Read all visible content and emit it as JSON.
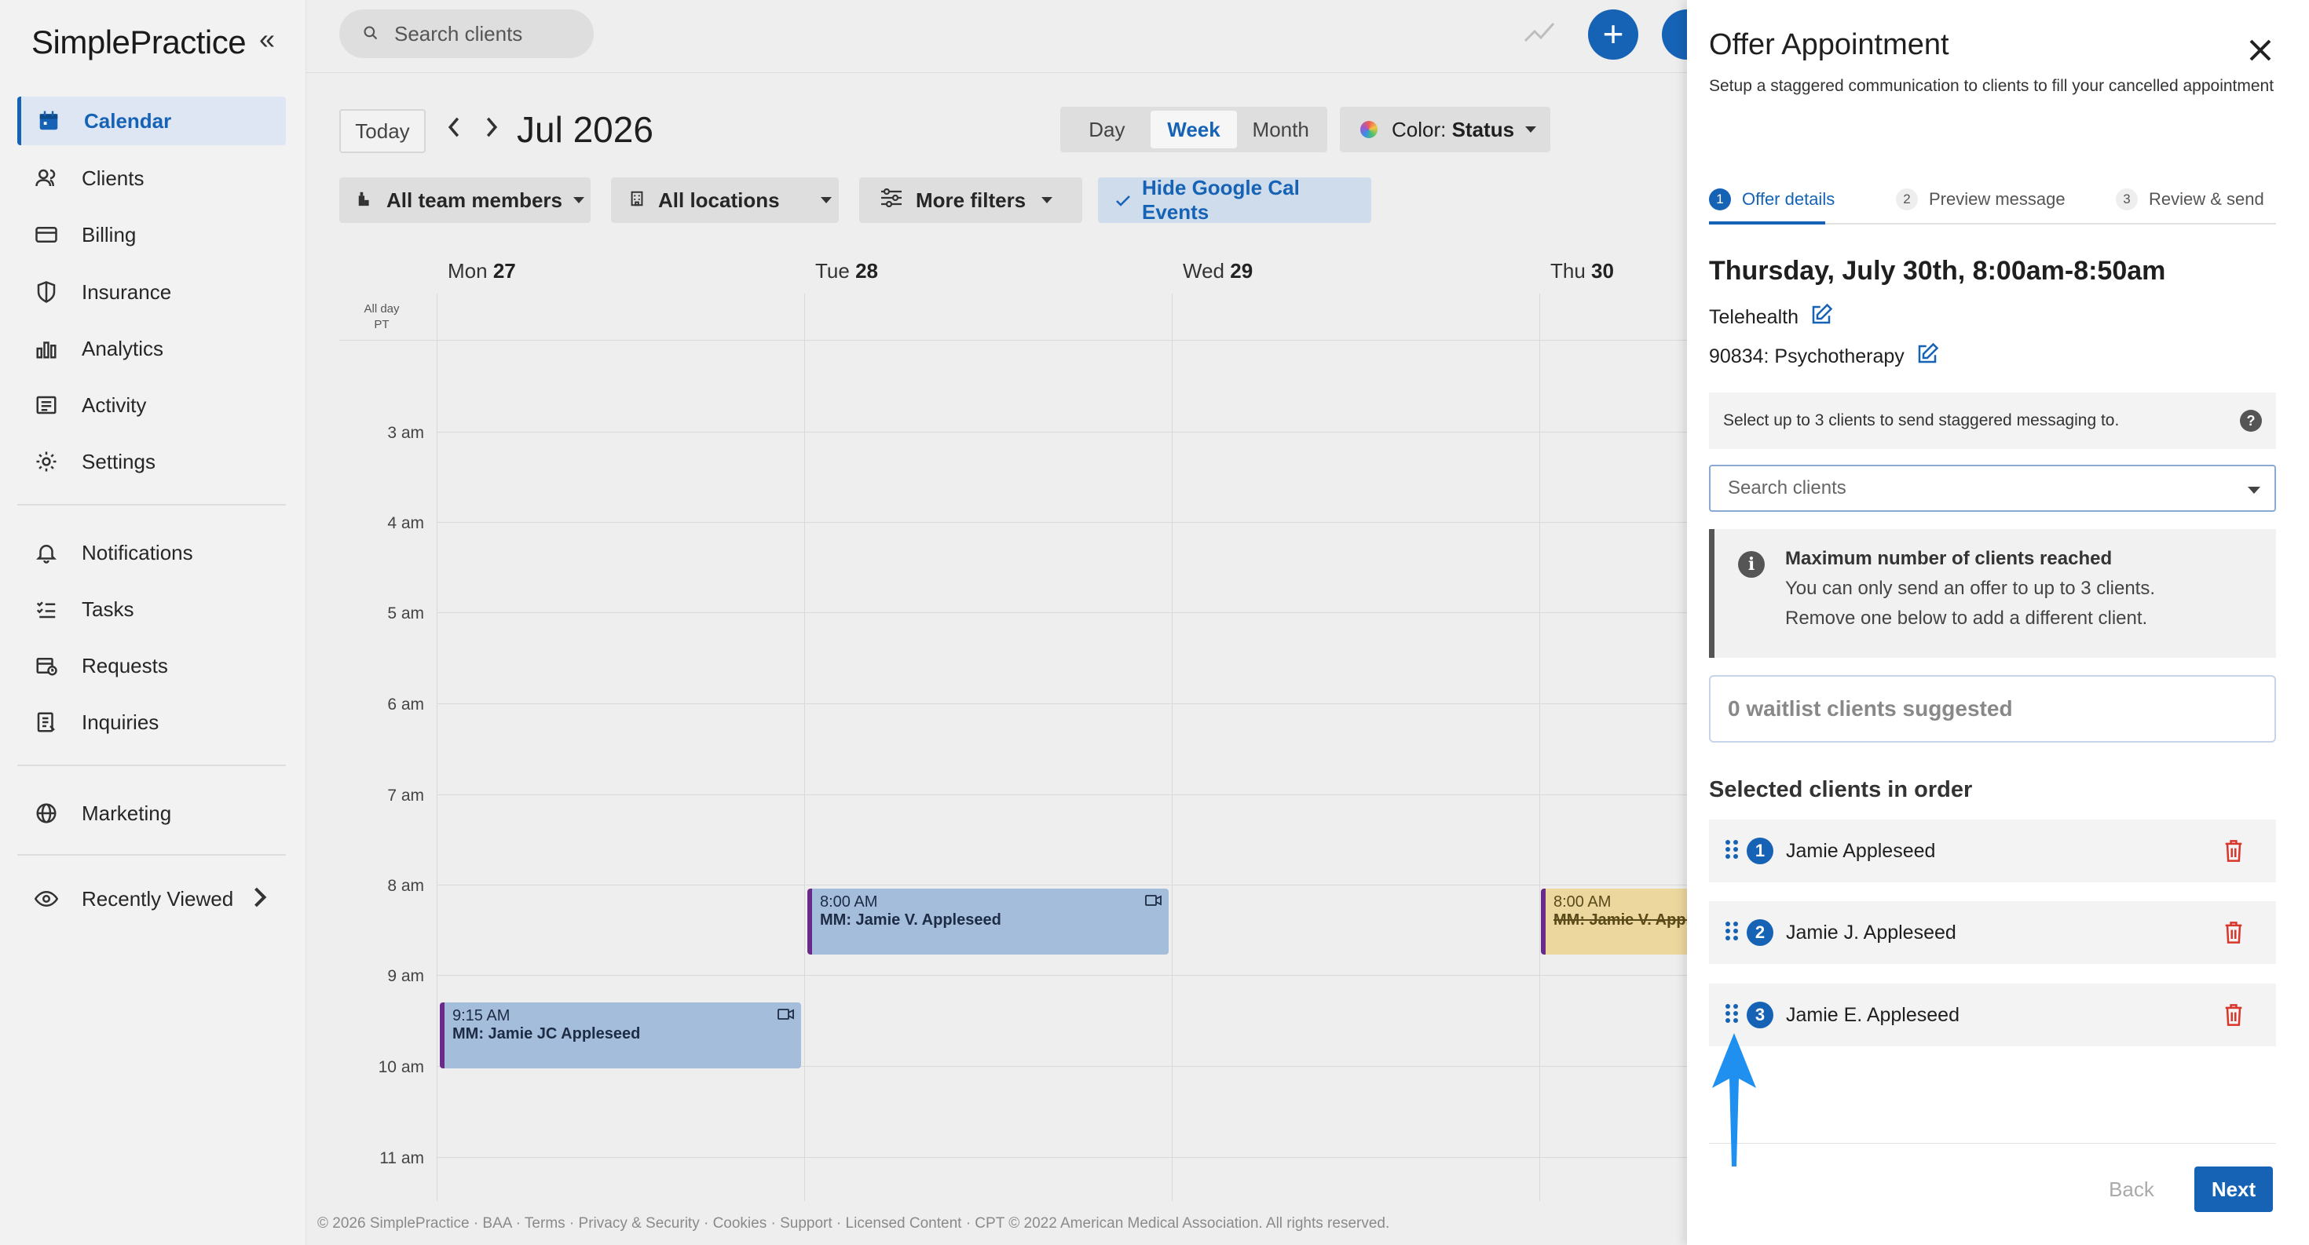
{
  "app": {
    "logo": "SimplePractice",
    "collapse": "«"
  },
  "sidebar": {
    "items": [
      {
        "label": "Calendar",
        "icon": "calendar-icon"
      },
      {
        "label": "Clients",
        "icon": "clients-icon"
      },
      {
        "label": "Billing",
        "icon": "billing-icon"
      },
      {
        "label": "Insurance",
        "icon": "shield-icon"
      },
      {
        "label": "Analytics",
        "icon": "bar-chart-icon"
      },
      {
        "label": "Activity",
        "icon": "activity-icon"
      },
      {
        "label": "Settings",
        "icon": "gear-icon"
      },
      {
        "label": "Notifications",
        "icon": "bell-icon"
      },
      {
        "label": "Tasks",
        "icon": "tasks-icon"
      },
      {
        "label": "Requests",
        "icon": "requests-icon"
      },
      {
        "label": "Inquiries",
        "icon": "inquiries-icon"
      },
      {
        "label": "Marketing",
        "icon": "globe-icon"
      },
      {
        "label": "Recently Viewed",
        "icon": "eye-icon"
      }
    ],
    "active": "Calendar"
  },
  "topbar": {
    "search_placeholder": "Search clients",
    "plus": "+"
  },
  "calendar": {
    "today": "Today",
    "prev": "‹",
    "next": "›",
    "month": "Jul 2026",
    "views": [
      "Day",
      "Week",
      "Month"
    ],
    "active_view": "Week",
    "color_prefix": "Color: ",
    "color_value": "Status",
    "filters": {
      "team": "All team members",
      "locations": "All locations",
      "more": "More filters",
      "gcal": "Hide Google Cal Events"
    },
    "days": [
      {
        "dow": "Mon",
        "num": "27"
      },
      {
        "dow": "Tue",
        "num": "28"
      },
      {
        "dow": "Wed",
        "num": "29"
      },
      {
        "dow": "Thu",
        "num": "30"
      }
    ],
    "allday_line1": "All day",
    "allday_line2": "PT",
    "times": [
      "3 am",
      "4 am",
      "5 am",
      "6 am",
      "7 am",
      "8 am",
      "9 am",
      "10 am",
      "11 am"
    ],
    "events": [
      {
        "time": "8:00 AM",
        "name": "MM: Jamie V. Appleseed"
      },
      {
        "time": "9:15 AM",
        "name": "MM: Jamie JC Appleseed"
      },
      {
        "time": "8:00 AM",
        "name": "MM: Jamie V. Appleseed"
      }
    ]
  },
  "footer": "© 2026 SimplePractice · BAA · Terms · Privacy & Security · Cookies · Support · Licensed Content · CPT © 2022 American Medical Association. All rights reserved.",
  "drawer": {
    "title": "Offer Appointment",
    "subtitle": "Setup a staggered communication to clients to fill your cancelled appointment",
    "steps": [
      {
        "num": "1",
        "label": "Offer details"
      },
      {
        "num": "2",
        "label": "Preview message"
      },
      {
        "num": "3",
        "label": "Review & send"
      }
    ],
    "appointment_date": "Thursday, July 30th, 8:00am-8:50am",
    "location": "Telehealth",
    "service": "90834: Psychotherapy",
    "select_note": "Select up to 3 clients to send staggered messaging to.",
    "search_placeholder": "Search clients",
    "alert": {
      "title": "Maximum number of clients reached",
      "line1": "You can only send an offer to up to 3 clients.",
      "line2": "Remove one below to add a different client."
    },
    "waitlist": "0 waitlist clients suggested",
    "selected_heading": "Selected clients in order",
    "clients": [
      {
        "order": "1",
        "name": "Jamie Appleseed"
      },
      {
        "order": "2",
        "name": "Jamie J. Appleseed"
      },
      {
        "order": "3",
        "name": "Jamie E. Appleseed"
      }
    ],
    "back": "Back",
    "next": "Next"
  },
  "colors": {
    "accent": "#1663b6",
    "event_blue": "#a4bddb",
    "event_yellow": "#ecd79e",
    "event_border": "#6a2a8a",
    "trash_red": "#d9362b",
    "annotation_arrow": "#1f8ff0"
  }
}
